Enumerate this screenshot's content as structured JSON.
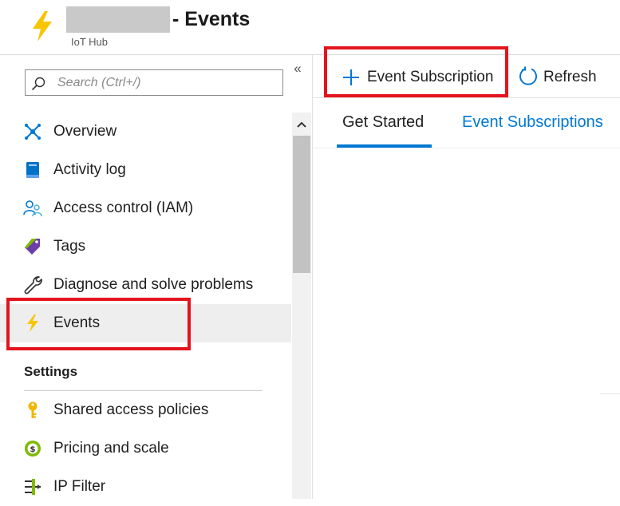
{
  "header": {
    "title": "- Events",
    "subtitle": "IoT Hub"
  },
  "sidebar": {
    "collapse_glyph": "«",
    "search_placeholder": "Search (Ctrl+/)",
    "items": [
      {
        "label": "Overview",
        "icon": "overview-icon"
      },
      {
        "label": "Activity log",
        "icon": "activity-log-icon"
      },
      {
        "label": "Access control (IAM)",
        "icon": "access-control-icon"
      },
      {
        "label": "Tags",
        "icon": "tags-icon"
      },
      {
        "label": "Diagnose and solve problems",
        "icon": "wrench-icon"
      },
      {
        "label": "Events",
        "icon": "lightning-icon",
        "selected": true
      }
    ],
    "section_settings": "Settings",
    "settings_items": [
      {
        "label": "Shared access policies",
        "icon": "key-icon"
      },
      {
        "label": "Pricing and scale",
        "icon": "pricing-icon"
      },
      {
        "label": "IP Filter",
        "icon": "ip-filter-icon"
      }
    ]
  },
  "toolbar": {
    "event_subscription_label": "Event Subscription",
    "refresh_label": "Refresh"
  },
  "tabs": [
    {
      "label": "Get Started",
      "active": true
    },
    {
      "label": "Event Subscriptions",
      "active": false
    }
  ],
  "colors": {
    "accent": "#0078d4",
    "highlight": "#e3141e",
    "lightning": "#f7c600"
  }
}
